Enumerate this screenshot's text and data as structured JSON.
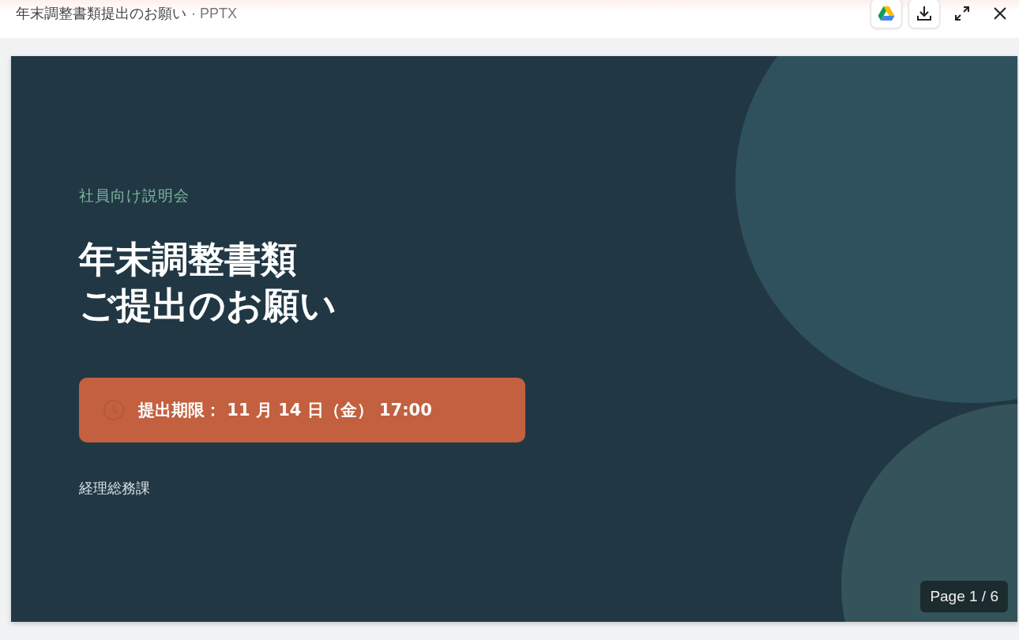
{
  "header": {
    "file_name": "年末調整書類提出のお願い",
    "file_type": "· PPTX",
    "actions": [
      {
        "kind": "drive"
      },
      {
        "kind": "download"
      },
      {
        "kind": "expand"
      },
      {
        "kind": "close"
      }
    ]
  },
  "slide": {
    "subtitle": "社員向け説明会",
    "title_lines": [
      "年末調整書類",
      "ご提出のお願い"
    ],
    "deadline": "提出期限： 11 月 14 日（金） 17:00",
    "department": "経理総務課"
  },
  "page_indicator": "Page 1 / 6"
}
